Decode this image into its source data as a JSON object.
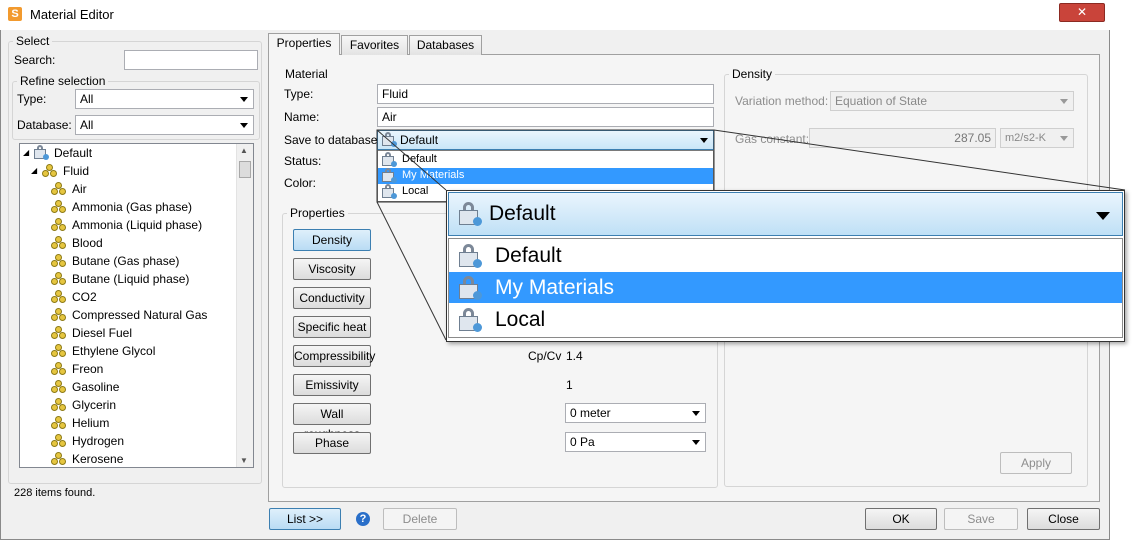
{
  "window": {
    "title": "Material Editor",
    "close_glyph": "✕"
  },
  "select_panel": {
    "group_title": "Select",
    "search_label": "Search:",
    "search_value": "",
    "refine_title": "Refine selection",
    "type_label": "Type:",
    "type_value": "All",
    "database_label": "Database:",
    "database_value": "All",
    "tree": {
      "root": "Default",
      "category": "Fluid",
      "items": [
        "Air",
        "Ammonia (Gas phase)",
        "Ammonia (Liquid phase)",
        "Blood",
        "Butane (Gas phase)",
        "Butane (Liquid phase)",
        "CO2",
        "Compressed Natural Gas",
        "Diesel Fuel",
        "Ethylene Glycol",
        "Freon",
        "Gasoline",
        "Glycerin",
        "Helium",
        "Hydrogen",
        "Kerosene"
      ]
    },
    "status": "228 items found."
  },
  "tabs": [
    "Properties",
    "Favorites",
    "Databases"
  ],
  "material": {
    "group_title": "Material",
    "type_label": "Type:",
    "type_value": "Fluid",
    "name_label": "Name:",
    "name_value": "Air",
    "save_label": "Save to database:",
    "save_value": "Default",
    "status_label": "Status:",
    "color_label": "Color:",
    "dropdown_options": [
      "Default",
      "My Materials",
      "Local"
    ],
    "highlighted_option": "My Materials"
  },
  "properties": {
    "group_title": "Properties",
    "buttons": [
      "Density",
      "Viscosity",
      "Conductivity",
      "Specific heat",
      "Compressibility",
      "Emissivity",
      "Wall roughness",
      "Phase"
    ],
    "cp_cv_label": "Cp/Cv",
    "cp_cv_value": "1.4",
    "emissivity_value": "1",
    "wall_roughness_value": "0 meter",
    "phase_value": "0 Pa"
  },
  "density": {
    "group_title": "Density",
    "variation_label": "Variation method:",
    "variation_value": "Equation of State",
    "gas_constant_label": "Gas constant:",
    "gas_constant_value": "287.05",
    "gas_constant_unit": "m2/s2-K",
    "apply_label": "Apply"
  },
  "zoom_callout": {
    "selected": "Default",
    "options": [
      "Default",
      "My Materials",
      "Local"
    ],
    "highlighted_option": "My Materials"
  },
  "footer": {
    "list_label": "List >>",
    "help_glyph": "?",
    "delete_label": "Delete",
    "ok_label": "OK",
    "save_label": "Save",
    "close_label": "Close"
  },
  "colors": {
    "accent": "#3399ff",
    "button_blue": "#b9dcf4",
    "window_bg": "#f0f0f0"
  }
}
